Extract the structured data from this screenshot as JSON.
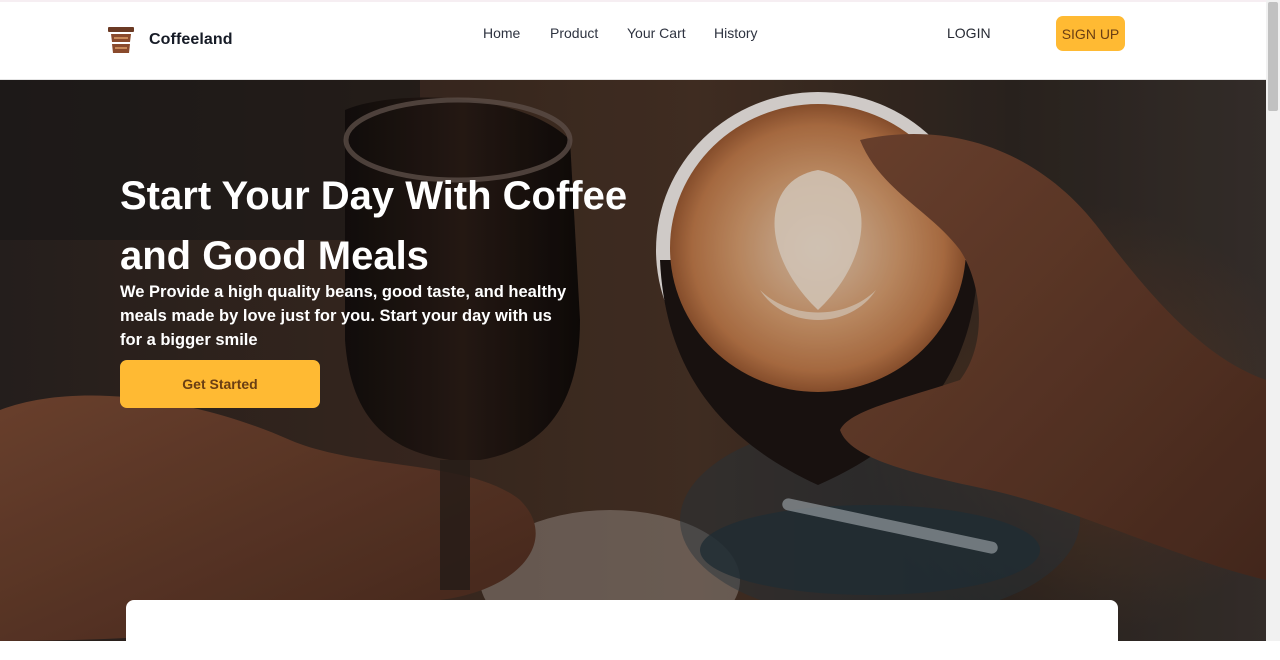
{
  "app": {
    "brand": "Coffeeland",
    "logo_icon": "coffee-cup-icon"
  },
  "nav": {
    "links": [
      {
        "label": "Home"
      },
      {
        "label": "Product"
      },
      {
        "label": "Your Cart"
      },
      {
        "label": "History"
      }
    ],
    "login_label": "LOGIN",
    "signup_label": "SIGN UP"
  },
  "hero": {
    "title": "Start Your Day With Coffee and Good Meals",
    "subtitle": "We Provide a high quality beans, good taste, and healthy meals made by love just for you. Start your day with us for a bigger smile",
    "cta_label": "Get Started",
    "background_image": "hands-holding-coffee-cups-photo"
  },
  "colors": {
    "accent": "#FFBA33",
    "accent_text": "#6A3E13",
    "brand_text": "#161B26",
    "nav_text": "#2E3340"
  }
}
